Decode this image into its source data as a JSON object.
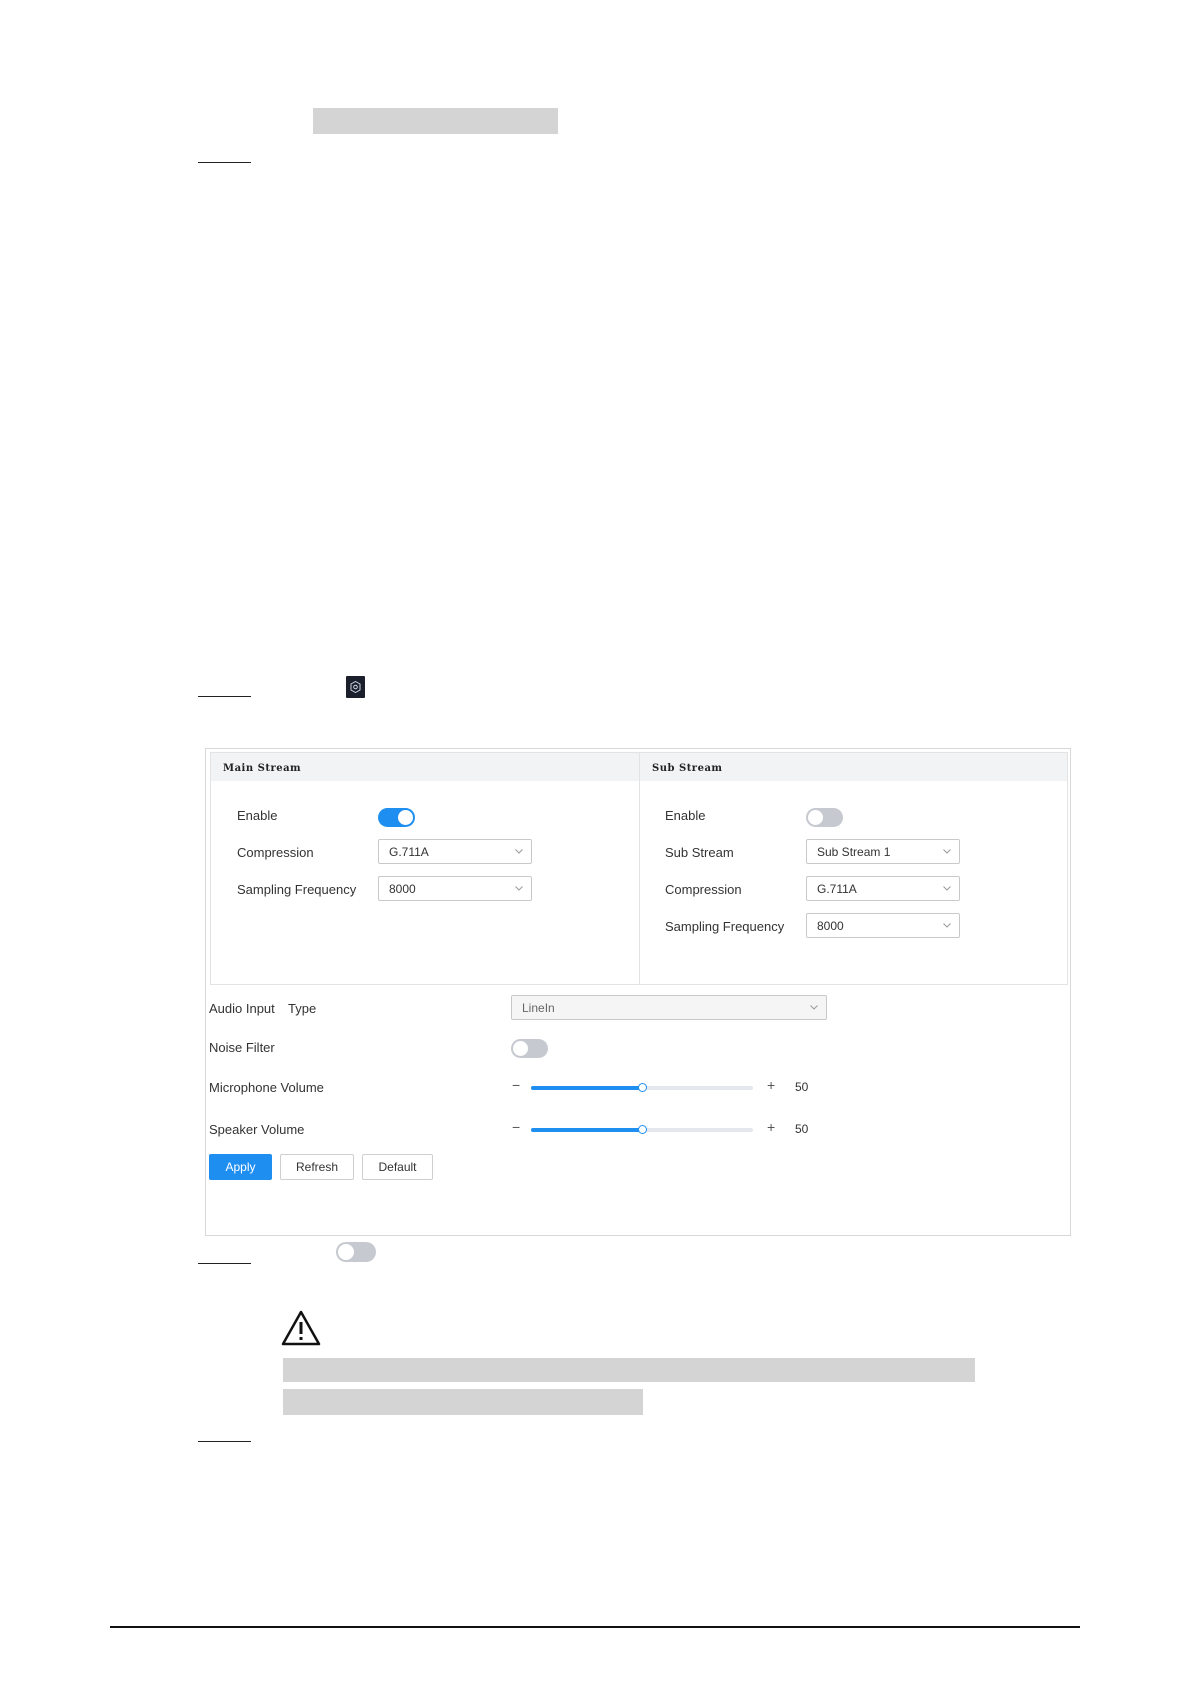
{
  "colors": {
    "accent": "#1f8ef1",
    "redaction": "#d4d4d4",
    "toggle_off": "#c6c9cf"
  },
  "main_stream": {
    "title": "Main Stream",
    "enable_label": "Enable",
    "enabled": true,
    "compression_label": "Compression",
    "compression_value": "G.711A",
    "sampling_label": "Sampling Frequency",
    "sampling_value": "8000"
  },
  "sub_stream": {
    "title": "Sub Stream",
    "enable_label": "Enable",
    "enabled": false,
    "stream_label": "Sub Stream",
    "stream_value": "Sub Stream 1",
    "compression_label": "Compression",
    "compression_value": "G.711A",
    "sampling_label": "Sampling Frequency",
    "sampling_value": "8000"
  },
  "audio_input": {
    "label": "Audio Input",
    "type_label": "Type",
    "value": "LineIn"
  },
  "noise_filter": {
    "label": "Noise Filter",
    "enabled": false
  },
  "microphone_volume": {
    "label": "Microphone Volume",
    "minus": "−",
    "plus": "+",
    "value": "50",
    "fraction": 0.5
  },
  "speaker_volume": {
    "label": "Speaker Volume",
    "minus": "−",
    "plus": "+",
    "value": "50",
    "fraction": 0.5
  },
  "buttons": {
    "apply": "Apply",
    "refresh": "Refresh",
    "default": "Default"
  },
  "icons": {
    "settings": "gear-icon",
    "warning": "warning-icon",
    "chevron": "chevron-down-icon"
  }
}
